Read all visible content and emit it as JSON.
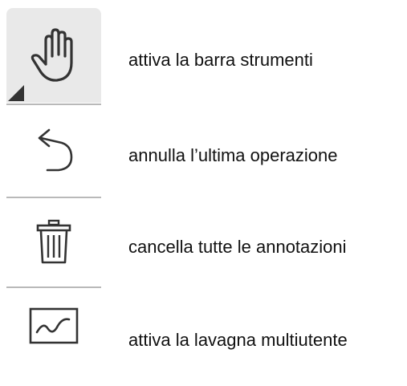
{
  "toolbar": {
    "tools": [
      {
        "icon": "hand-icon",
        "description": "attiva la barra strumenti"
      },
      {
        "icon": "undo-icon",
        "description": "annulla l’ultima operazione"
      },
      {
        "icon": "trash-icon",
        "description": "cancella tutte le annotazioni"
      },
      {
        "icon": "whiteboard-icon",
        "description": "attiva la lavagna multiutente"
      }
    ]
  },
  "colors": {
    "active_background": "#e9e9e9",
    "divider": "#b9b9b9",
    "icon_stroke": "#333333",
    "text": "#111111"
  }
}
